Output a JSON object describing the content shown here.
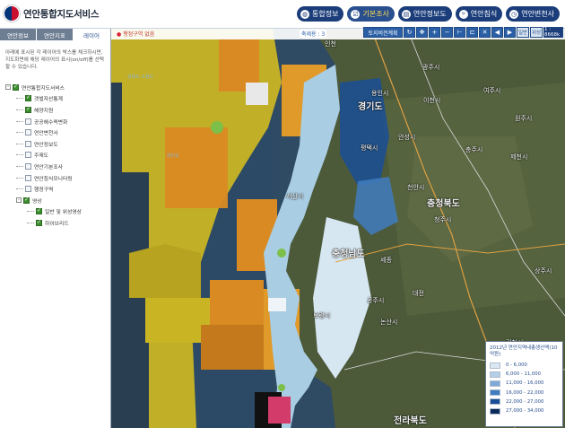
{
  "app": {
    "title": "연안통합지도서비스"
  },
  "topnav": [
    {
      "label": "통합정보",
      "icon": "globe-icon",
      "active": false
    },
    {
      "label": "기본조사",
      "icon": "checklist-icon",
      "active": true
    },
    {
      "label": "연안정보도",
      "icon": "book-icon",
      "active": false
    },
    {
      "label": "연안침식",
      "icon": "wave-icon",
      "active": false
    },
    {
      "label": "연안변천사",
      "icon": "history-icon",
      "active": false
    }
  ],
  "left_tabs": [
    "연안정보",
    "연안지표",
    "레이어"
  ],
  "left_desc": "아래에 표시된 각 레이어의 박스를 체크하시면, 지도화면에 해당 레이어의 표시(on/off)를 선택할 수 있습니다.",
  "tree": [
    {
      "label": "연안통합지도서비스",
      "level": 0,
      "checked": true,
      "toggle": "-"
    },
    {
      "label": "갯벌자산통계",
      "level": 1,
      "checked": true
    },
    {
      "label": "해양지원",
      "level": 1,
      "checked": true
    },
    {
      "label": "공공해수욕변화",
      "level": 1,
      "checked": false
    },
    {
      "label": "연안변천사",
      "level": 1,
      "checked": false
    },
    {
      "label": "연안정보도",
      "level": 1,
      "checked": false
    },
    {
      "label": "주제도",
      "level": 1,
      "checked": false
    },
    {
      "label": "연안기본조사",
      "level": 1,
      "checked": false
    },
    {
      "label": "연안침식모니터링",
      "level": 1,
      "checked": false
    },
    {
      "label": "행정구역",
      "level": 1,
      "checked": false
    },
    {
      "label": "영상",
      "level": 1,
      "checked": true,
      "toggle": "-"
    },
    {
      "label": "일반 및 위성영상",
      "level": 2,
      "checked": true
    },
    {
      "label": "하이브리드",
      "level": 2,
      "checked": true
    }
  ],
  "map_top": {
    "region_label": "행정구역 없음",
    "scale_text": "축제용 : 3"
  },
  "tools": {
    "map_btn": "토지비전계획",
    "icons": [
      "refresh-icon",
      "pan-icon",
      "zoom-in-icon",
      "zoom-out-icon",
      "measure-distance-icon",
      "measure-area-icon",
      "clear-icon",
      "prev-icon",
      "next-icon",
      "fullscreen-icon"
    ],
    "extra": [
      "일반",
      "위성"
    ],
    "scale": "1 : 8668k"
  },
  "map_labels": [
    {
      "text": "인천",
      "kind": "city"
    },
    {
      "text": "경기도",
      "kind": "province"
    },
    {
      "text": "광주시",
      "kind": "city"
    },
    {
      "text": "용인시",
      "kind": "city"
    },
    {
      "text": "이천시",
      "kind": "city"
    },
    {
      "text": "여주시",
      "kind": "city"
    },
    {
      "text": "평택시",
      "kind": "city"
    },
    {
      "text": "안성시",
      "kind": "city"
    },
    {
      "text": "충주시",
      "kind": "city"
    },
    {
      "text": "천안시",
      "kind": "city"
    },
    {
      "text": "충청북도",
      "kind": "province"
    },
    {
      "text": "청주시",
      "kind": "city"
    },
    {
      "text": "서산시",
      "kind": "city"
    },
    {
      "text": "충청남도",
      "kind": "province"
    },
    {
      "text": "세종",
      "kind": "city"
    },
    {
      "text": "대전",
      "kind": "city"
    },
    {
      "text": "공주시",
      "kind": "city"
    },
    {
      "text": "보령시",
      "kind": "city"
    },
    {
      "text": "논산시",
      "kind": "city"
    },
    {
      "text": "상주시",
      "kind": "city"
    },
    {
      "text": "김천시",
      "kind": "city"
    },
    {
      "text": "전라북도",
      "kind": "province"
    },
    {
      "text": "제천시",
      "kind": "city"
    },
    {
      "text": "원주시",
      "kind": "city"
    },
    {
      "text": "강화도 소청도",
      "kind": "sea"
    },
    {
      "text": "태안도",
      "kind": "sea"
    }
  ],
  "legend": {
    "title": "2012년 연안지역내총생산액(10억원)",
    "rows": [
      {
        "label": "0 - 6,000",
        "color": "#dbe8f4"
      },
      {
        "label": "6,000 - 11,000",
        "color": "#b5cfe8"
      },
      {
        "label": "11,000 - 16,000",
        "color": "#7fa9d6"
      },
      {
        "label": "16,000 - 22,000",
        "color": "#3f7cc0"
      },
      {
        "label": "22,000 - 27,000",
        "color": "#1a4f96"
      },
      {
        "label": "27,000 - 34,000",
        "color": "#0a2a5a"
      }
    ]
  },
  "colors": {
    "header_btn": "#1b3d7a",
    "accent": "#ffe14d",
    "orange": "#e08c1e",
    "yellow": "#e6c21e"
  }
}
